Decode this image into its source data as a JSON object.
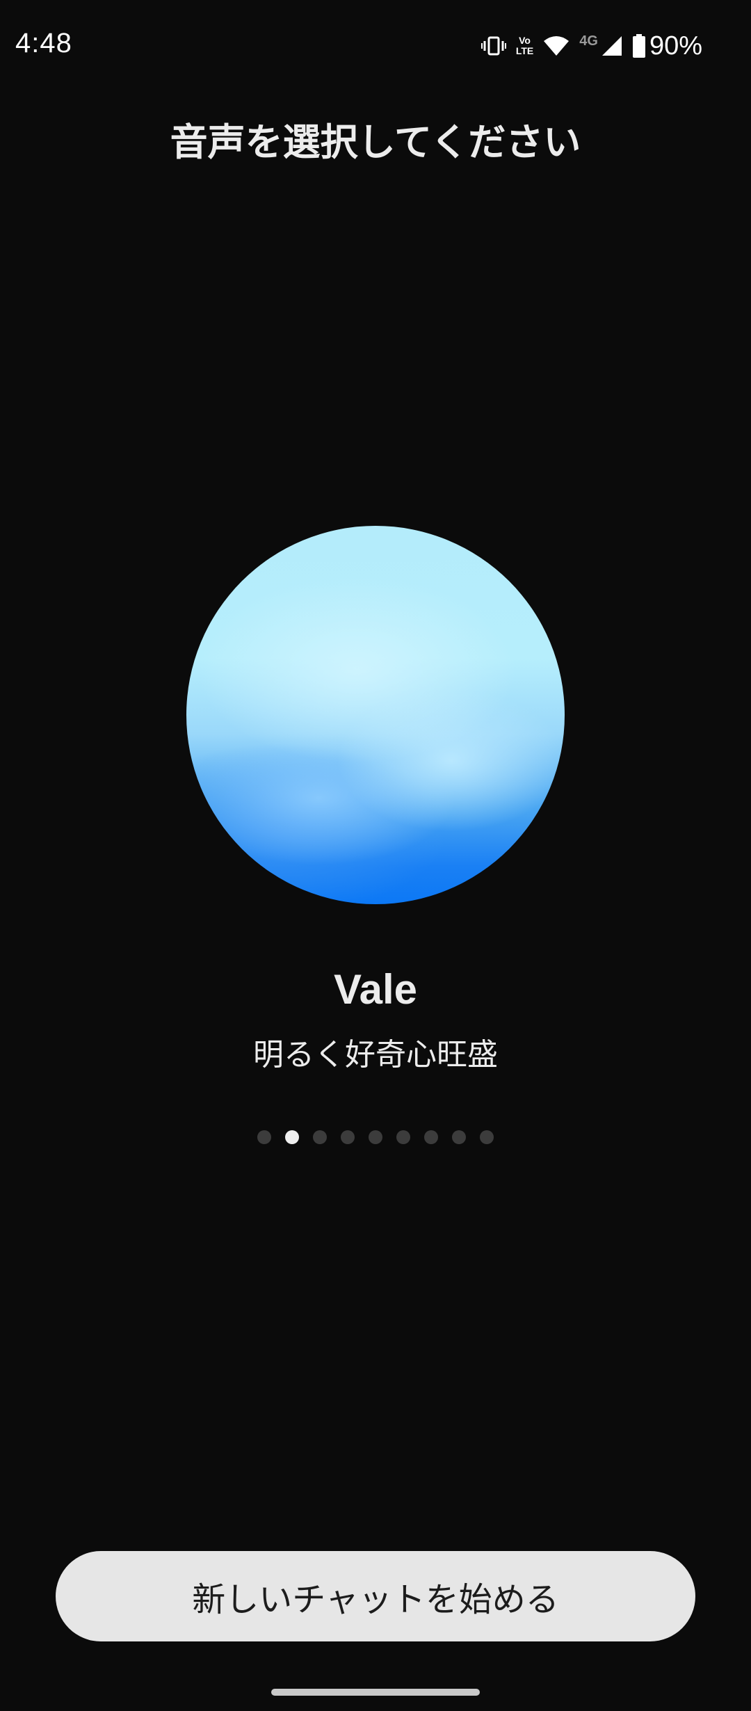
{
  "status_bar": {
    "time": "4:48",
    "icons": [
      "vibrate-icon",
      "volte-icon",
      "wifi-icon",
      "4g-icon",
      "signal-icon",
      "battery-icon"
    ],
    "volte_top": "Vo",
    "volte_bottom": "LTE",
    "network": "4G",
    "battery_percent": "90%"
  },
  "header": {
    "title": "音声を選択してください"
  },
  "voice": {
    "name": "Vale",
    "description": "明るく好奇心旺盛",
    "orb_colors": {
      "top": "#b4ecfb",
      "bottom": "#0c78f5"
    }
  },
  "pagination": {
    "total": 9,
    "current": 2
  },
  "actions": {
    "start_label": "新しいチャットを始める"
  },
  "colors": {
    "background": "#0b0b0b",
    "button_bg": "#e6e6e6",
    "dot_active": "#efefef",
    "dot_inactive": "#3c3c3c"
  }
}
